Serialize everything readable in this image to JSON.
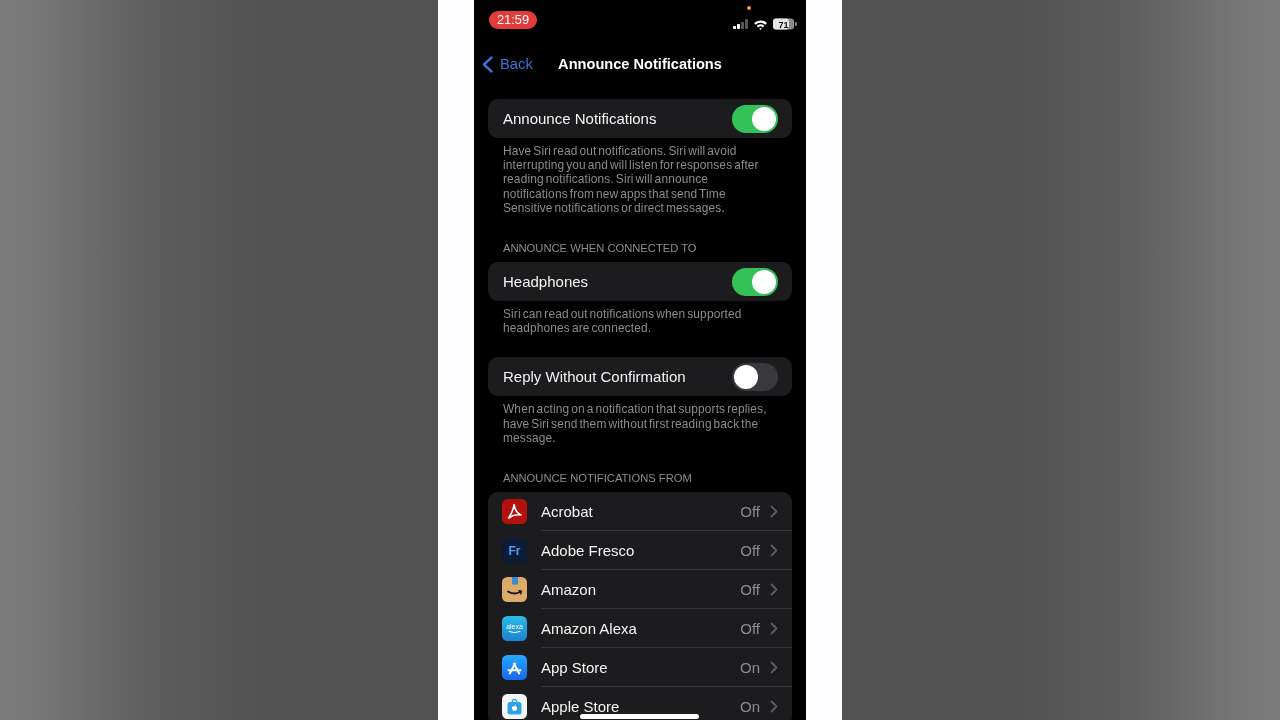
{
  "status_bar": {
    "time": "21:59",
    "battery": "71"
  },
  "nav_bar": {
    "back": "Back",
    "title": "Announce Notifications"
  },
  "sections": [
    {
      "kind": "toggles",
      "rows": [
        {
          "label": "Announce Notifications",
          "on": true
        }
      ],
      "footer": "Have Siri read out notifications. Siri will avoid interrupting you and will listen for responses after reading notifications. Siri will announce notifications from new apps that send Time Sensitive notifications or direct messages."
    },
    {
      "kind": "toggles",
      "header": "ANNOUNCE WHEN CONNECTED TO",
      "rows": [
        {
          "label": "Headphones",
          "on": true
        }
      ],
      "footer": "Siri can read out notifications when supported headphones are connected."
    },
    {
      "kind": "toggles",
      "rows": [
        {
          "label": "Reply Without Confirmation",
          "on": false
        }
      ],
      "footer": "When acting on a notification that supports replies, have Siri send them without first reading back the message."
    },
    {
      "kind": "apps",
      "header": "ANNOUNCE NOTIFICATIONS FROM",
      "rows": [
        {
          "name": "Acrobat",
          "value": "Off"
        },
        {
          "name": "Adobe Fresco",
          "icon_text": "Fr",
          "value": "Off"
        },
        {
          "name": "Amazon",
          "value": "Off"
        },
        {
          "name": "Amazon Alexa",
          "icon_text": "alexa",
          "value": "Off"
        },
        {
          "name": "App Store",
          "value": "On"
        },
        {
          "name": "Apple Store",
          "value": "On"
        }
      ]
    }
  ]
}
